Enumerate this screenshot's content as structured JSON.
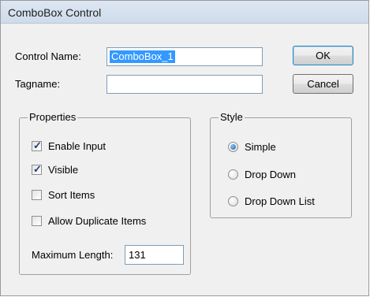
{
  "window": {
    "title": "ComboBox Control"
  },
  "form": {
    "control_name_label": "Control Name:",
    "control_name_value": "ComboBox_1",
    "tagname_label": "Tagname:",
    "tagname_value": ""
  },
  "buttons": {
    "ok": "OK",
    "cancel": "Cancel"
  },
  "properties": {
    "title": "Properties",
    "items": [
      {
        "label": "Enable Input",
        "checked": true
      },
      {
        "label": "Visible",
        "checked": true
      },
      {
        "label": "Sort Items",
        "checked": false
      },
      {
        "label": "Allow Duplicate Items",
        "checked": false
      }
    ],
    "max_length_label": "Maximum Length:",
    "max_length_value": "131"
  },
  "style": {
    "title": "Style",
    "options": [
      {
        "label": "Simple",
        "selected": true
      },
      {
        "label": "Drop Down",
        "selected": false
      },
      {
        "label": "Drop Down List",
        "selected": false
      }
    ]
  },
  "colors": {
    "accent": "#3399ff",
    "titlebar": "#d6e1ee"
  }
}
